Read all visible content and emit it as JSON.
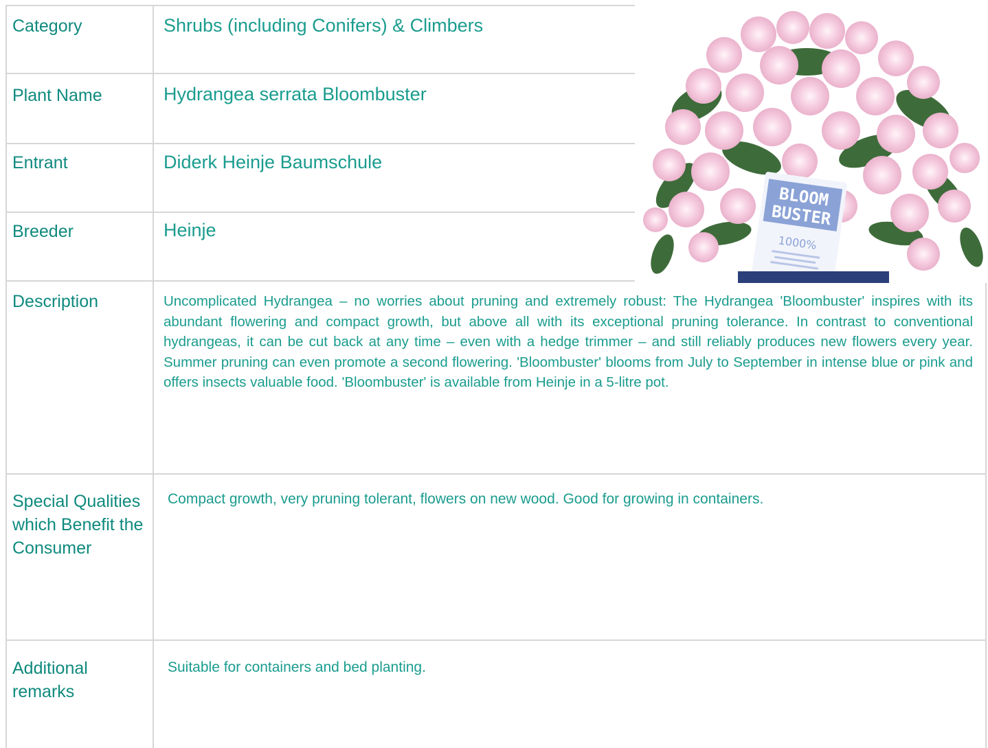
{
  "rows": [
    {
      "label": "Category",
      "value": "Shrubs (including Conifers) & Climbers"
    },
    {
      "label": "Plant Name",
      "value": "Hydrangea serrata Bloombuster"
    },
    {
      "label": "Entrant",
      "value": "Diderk Heinje Baumschule"
    },
    {
      "label": "Breeder",
      "value": "Heinje"
    },
    {
      "label": "Description",
      "value": "Uncomplicated Hydrangea – no worries about pruning and extremely robust: The Hydrangea 'Bloombuster' inspires with its abundant flowering and compact growth, but above all with its exceptional pruning tolerance. In contrast to conventional hydrangeas, it can be cut back at any time – even with a hedge trimmer – and still reliably produces new flowers every year. Summer pruning can even promote a second flowering. 'Bloombuster' blooms from July to September in intense blue or pink and offers insects valuable food. 'Bloombuster' is available from Heinje in a 5-litre pot."
    },
    {
      "label": "Special Qualities which Benefit the Consumer",
      "value": "Compact growth, very pruning tolerant, flowers on new wood. Good for growing in containers."
    },
    {
      "label": "Additional remarks",
      "value": "Suitable for containers and bed planting."
    }
  ],
  "photo": {
    "tag_lines": [
      "BLOOM",
      "BUSTER",
      "1000%"
    ],
    "colors": {
      "flower": "#f3c6dc",
      "leaf": "#3e6b3a",
      "tag": "#8aa2d6"
    }
  },
  "colors": {
    "label": "#0f8a7e",
    "value": "#1a9c8e",
    "border": "#d6d6d6"
  }
}
